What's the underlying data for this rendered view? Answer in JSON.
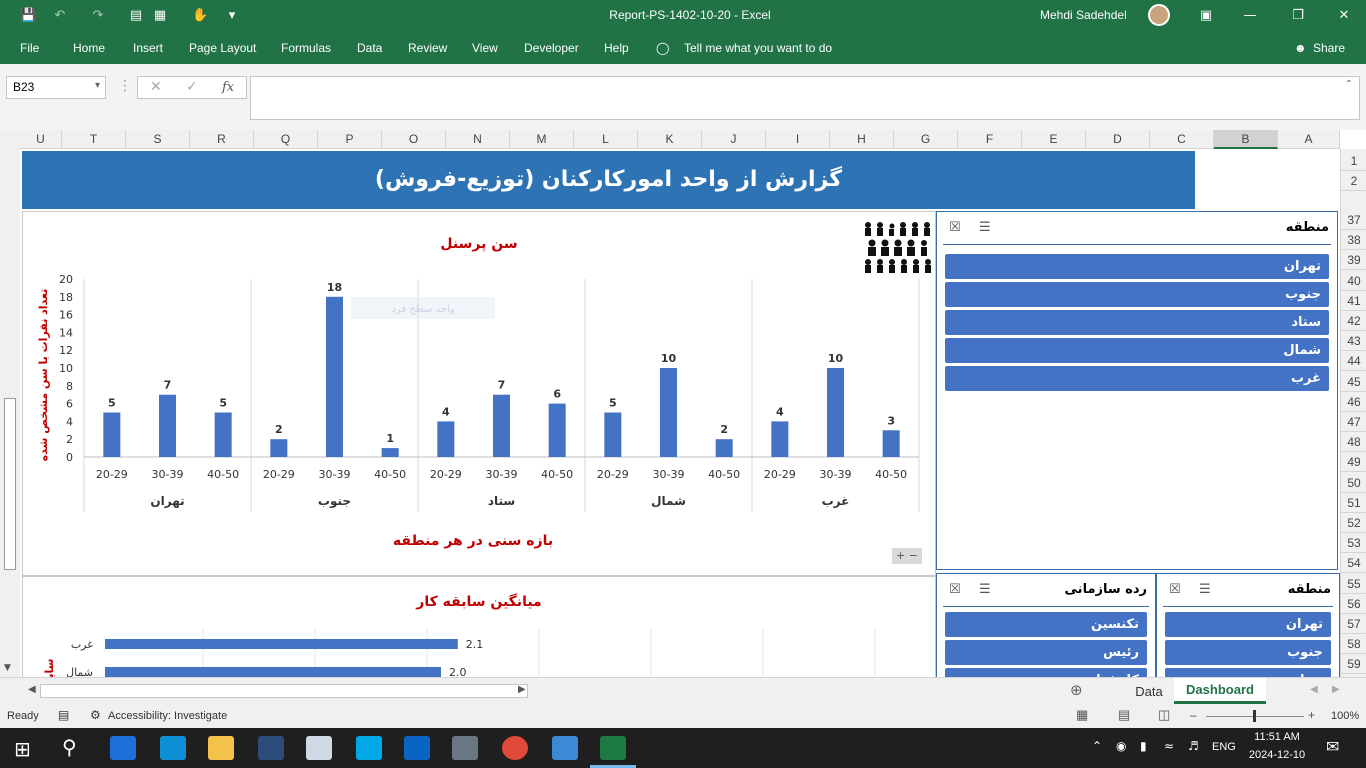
{
  "window": {
    "title": "Report-PS-1402-10-20  -  Excel",
    "user": "Mehdi Sadehdel"
  },
  "ribbon": {
    "tabs": [
      "File",
      "Home",
      "Insert",
      "Page Layout",
      "Formulas",
      "Data",
      "Review",
      "View",
      "Developer",
      "Help"
    ],
    "tell_me": "Tell me what you want to do",
    "share": "Share"
  },
  "formula_bar": {
    "name_box": "B23",
    "fx": "fx",
    "value": ""
  },
  "columns": [
    "U",
    "T",
    "S",
    "R",
    "Q",
    "P",
    "O",
    "N",
    "M",
    "L",
    "K",
    "J",
    "I",
    "H",
    "G",
    "F",
    "E",
    "D",
    "C",
    "B",
    "A"
  ],
  "rows": [
    "1",
    "2",
    "37",
    "38",
    "39",
    "40",
    "41",
    "42",
    "43",
    "44",
    "45",
    "46",
    "47",
    "48",
    "49",
    "50",
    "51",
    "52",
    "53",
    "54",
    "55",
    "56",
    "57",
    "58",
    "59"
  ],
  "report": {
    "banner_title": "گزارش از واحد امورکارکنان (توزیع-فروش)"
  },
  "age_chart": {
    "title": "سن پرسنل",
    "ylabel": "تعداد نفرات با سن مشخص شده",
    "xlabel": "بازه سنی در هر منطقه",
    "ghost_label": "واحد سطح فرد"
  },
  "chart_data": [
    {
      "type": "bar",
      "title": "سن پرسنل",
      "ylabel": "تعداد نفرات با سن مشخص شده",
      "xlabel": "بازه سنی در هر منطقه",
      "ylim": [
        0,
        20
      ],
      "yticks": [
        0,
        2,
        4,
        6,
        8,
        10,
        12,
        14,
        16,
        18,
        20
      ],
      "groups": [
        "تهران",
        "جنوب",
        "ستاد",
        "شمال",
        "غرب"
      ],
      "categories": [
        "20-29",
        "30-39",
        "40-50"
      ],
      "values": [
        [
          5,
          7,
          5
        ],
        [
          2,
          18,
          1
        ],
        [
          4,
          7,
          6
        ],
        [
          5,
          10,
          2
        ],
        [
          4,
          10,
          3
        ]
      ],
      "grid": false,
      "color": "#4472c4"
    },
    {
      "type": "bar",
      "orientation": "horizontal",
      "title": "میانگین سابقه کار",
      "categories": [
        "غرب",
        "شمال"
      ],
      "values": [
        2.1,
        2.0
      ],
      "color": "#4472c4"
    }
  ],
  "tenure_chart": {
    "title": "میانگین سابقه کار",
    "ylabel_partial": "سابق"
  },
  "slicers": {
    "region_top": {
      "title": "منطقه",
      "items": [
        "تهران",
        "جنوب",
        "ستاد",
        "شمال",
        "غرب"
      ]
    },
    "org_level": {
      "title": "رده سازمانی",
      "items": [
        "تکنسین",
        "رئیس",
        "کارشناس"
      ]
    },
    "region_bottom": {
      "title": "منطقه",
      "items": [
        "تهران",
        "جنوب",
        "ستاد"
      ]
    }
  },
  "sheet_tabs": [
    "Data",
    "Dashboard"
  ],
  "active_tab": "Dashboard",
  "status": {
    "ready": "Ready",
    "accessibility": "Accessibility: Investigate",
    "zoom": "100%"
  },
  "taskbar": {
    "lang": "ENG",
    "time": "11:51 AM",
    "date": "2024-12-10"
  }
}
